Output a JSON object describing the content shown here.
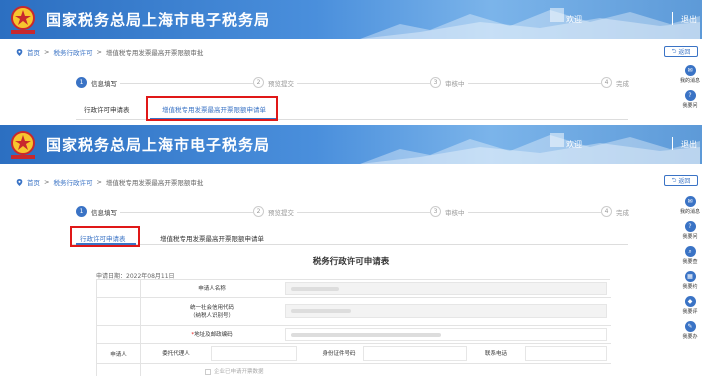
{
  "header": {
    "title": "国家税务总局上海市电子税务局",
    "welcome": "欢迎",
    "logout": "退出",
    "logo_text": "中国税务"
  },
  "breadcrumb": {
    "home": "首页",
    "level1": "税务行政许可",
    "current": "增值税专用发票最高开票限额审批"
  },
  "back_label": "返回",
  "steps": [
    {
      "num": "1",
      "label": "信息填写"
    },
    {
      "num": "2",
      "label": "预览提交"
    },
    {
      "num": "3",
      "label": "审核中"
    },
    {
      "num": "4",
      "label": "完成"
    }
  ],
  "tabs": {
    "permit": "行政许可申请表",
    "permit_short": "行政许可申请表",
    "limit": "增值税专用发票最高开票限额申请单",
    "limit_short": "增值税专用发票最高开票限额申请单"
  },
  "sidebar": [
    {
      "icon": "chat-icon",
      "label": "我的消息"
    },
    {
      "icon": "question-icon",
      "label": "我要问"
    },
    {
      "icon": "search-icon",
      "label": "我要查"
    },
    {
      "icon": "calendar-icon",
      "label": "我要约"
    },
    {
      "icon": "shield-icon",
      "label": "我要评"
    },
    {
      "icon": "pen-icon",
      "label": "我要办"
    }
  ],
  "form": {
    "title": "税务行政许可申请表",
    "date": "申请日期：2022年08月11日",
    "applicant_name": "申请人名称",
    "credit_code_1": "统一社会信用代码",
    "credit_code_2": "（纳税人识别号）",
    "req_mark": "*",
    "address": "地址及邮政编码",
    "agent": "委托代理人",
    "id_no": "身份证件号码",
    "phone": "联系电话",
    "applicant": "申请人",
    "ca_option": "企业已申请开票数据"
  },
  "colors": {
    "accent": "#3a73c5",
    "highlight": "#e01818"
  }
}
